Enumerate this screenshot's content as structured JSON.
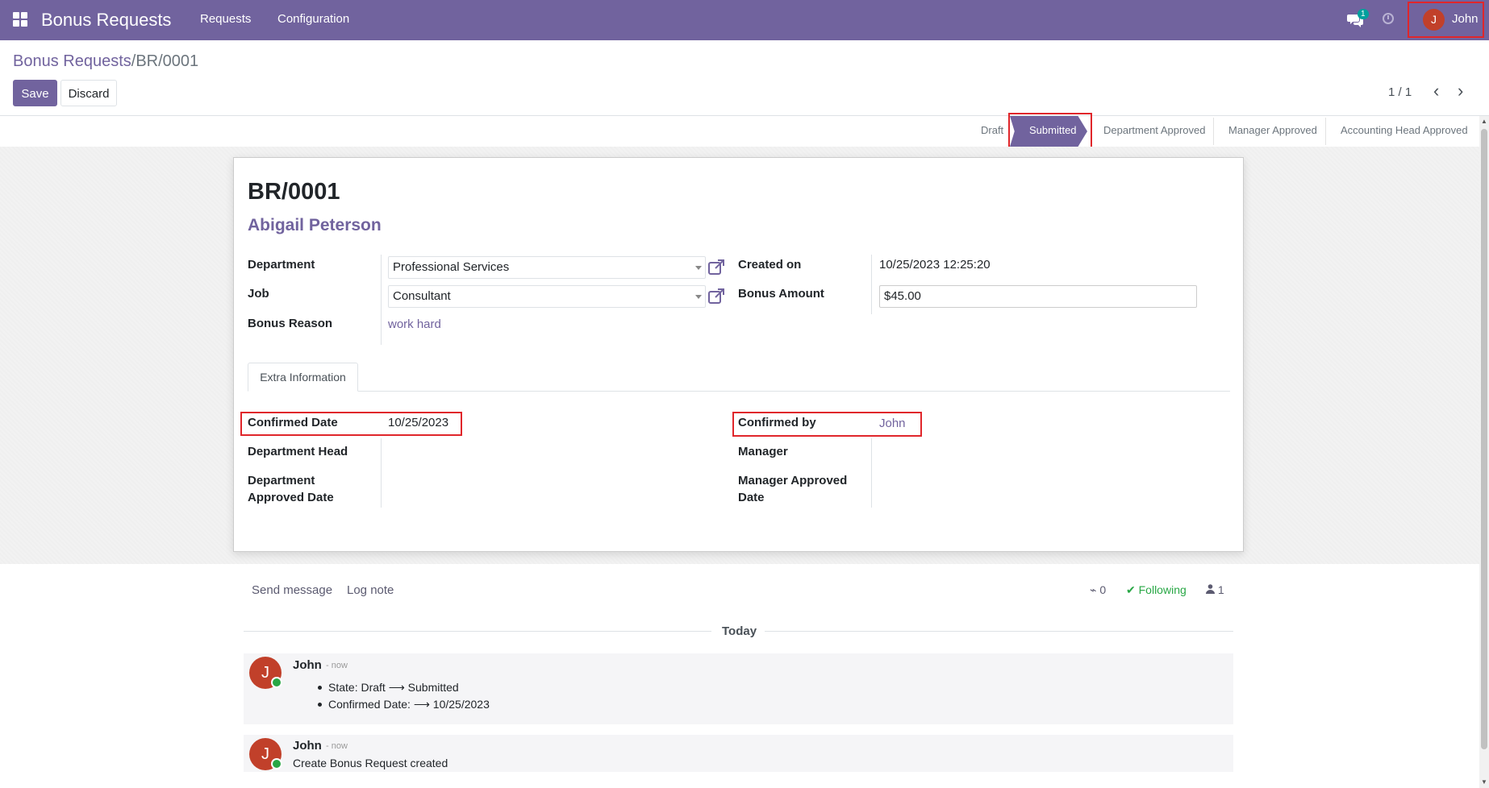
{
  "navbar": {
    "app_name": "Bonus Requests",
    "menus": [
      "Requests",
      "Configuration"
    ],
    "chat_badge": "1",
    "user_initial": "J",
    "user_name": "John",
    "color": "#71639e"
  },
  "breadcrumb": {
    "parent": "Bonus Requests",
    "separator": "/",
    "current": "BR/0001"
  },
  "buttons": {
    "save": "Save",
    "discard": "Discard"
  },
  "pager": {
    "value": "1 / 1"
  },
  "statusbar": {
    "stages": [
      "Draft",
      "Submitted",
      "Department Approved",
      "Manager Approved",
      "Accounting Head Approved"
    ],
    "active": "Submitted"
  },
  "record": {
    "reference": "BR/0001",
    "employee": "Abigail Peterson",
    "fields_left": {
      "department_label": "Department",
      "department_value": "Professional Services",
      "job_label": "Job",
      "job_value": "Consultant",
      "reason_label": "Bonus Reason",
      "reason_value": "work hard"
    },
    "fields_right": {
      "created_label": "Created on",
      "created_value": "10/25/2023 12:25:20",
      "amount_label": "Bonus Amount",
      "amount_value": "$45.00"
    }
  },
  "tabs": {
    "extra_info": "Extra Information"
  },
  "extra": {
    "confirmed_date_label": "Confirmed Date",
    "confirmed_date_value": "10/25/2023",
    "dept_head_label": "Department Head",
    "dept_approved_label_1": "Department",
    "dept_approved_label_2": "Approved Date",
    "confirmed_by_label": "Confirmed by",
    "confirmed_by_value": "John",
    "manager_label": "Manager",
    "manager_approved_label_1": "Manager Approved",
    "manager_approved_label_2": "Date"
  },
  "chatter": {
    "send_message": "Send message",
    "log_note": "Log note",
    "attachments": "0",
    "following": "Following",
    "followers": "1",
    "today": "Today",
    "messages": [
      {
        "initial": "J",
        "author": "John",
        "time": "- now",
        "lines": [
          "State: Draft ⟶ Submitted",
          "Confirmed Date: ⟶ 10/25/2023"
        ]
      },
      {
        "initial": "J",
        "author": "John",
        "time": "- now",
        "body": "Create Bonus Request created"
      }
    ]
  }
}
